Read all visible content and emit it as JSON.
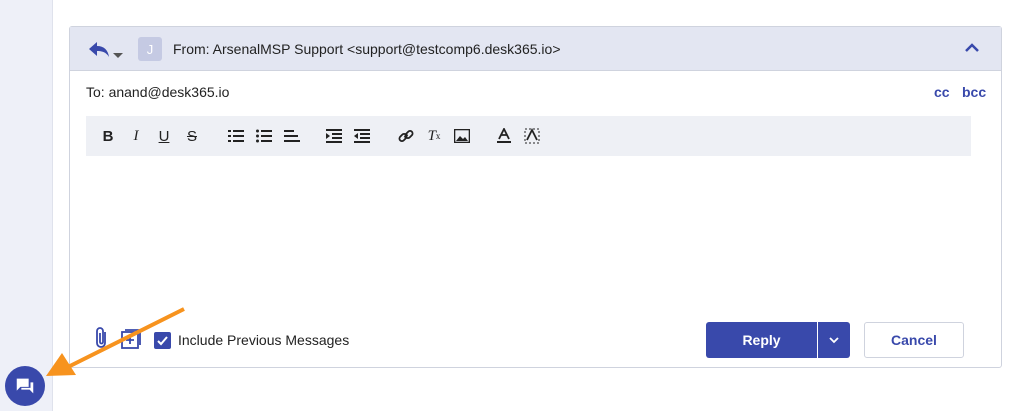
{
  "composer": {
    "avatar_initial": "J",
    "from_text": "From:  ArsenalMSP Support <support@testcomp6.desk365.io>",
    "to_text": "To: anand@desk365.io",
    "cc_label": "cc",
    "bcc_label": "bcc",
    "toolbar": [
      "bold-icon",
      "italic-icon",
      "underline-icon",
      "strikethrough-icon",
      "ordered-list-icon",
      "bullet-list-icon",
      "align-left-icon",
      "indent-increase-icon",
      "indent-decrease-icon",
      "link-icon",
      "clear-format-icon",
      "image-icon",
      "text-color-icon",
      "highlight-color-icon"
    ],
    "include_previous_label": "Include Previous Messages",
    "include_previous_checked": true,
    "reply_label": "Reply",
    "cancel_label": "Cancel"
  },
  "colors": {
    "accent": "#3949ab",
    "annotation_arrow": "#f7931e",
    "sidebar": "#eef0f8",
    "header": "#e3e6f2"
  }
}
